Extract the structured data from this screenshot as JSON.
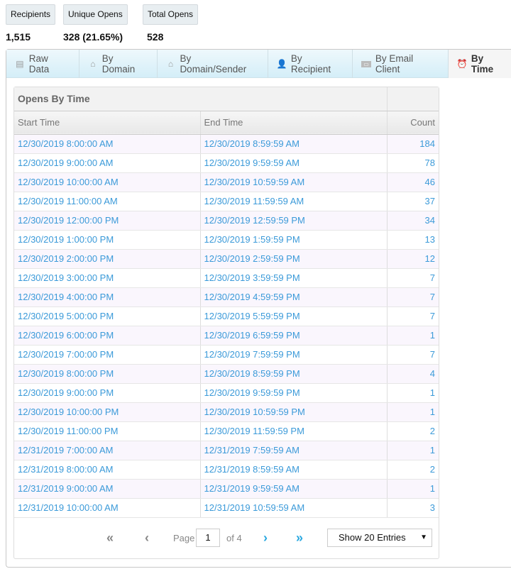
{
  "stats": [
    {
      "label": "Recipients",
      "value": "1,515"
    },
    {
      "label": "Unique Opens",
      "value": "328 (21.65%)"
    },
    {
      "label": "Total Opens",
      "value": "528"
    }
  ],
  "tabs": [
    {
      "label": "Raw Data",
      "icon": "table-icon"
    },
    {
      "label": "By Domain",
      "icon": "house-icon"
    },
    {
      "label": "By Domain/Sender",
      "icon": "house-icon"
    },
    {
      "label": "By Recipient",
      "icon": "person-icon"
    },
    {
      "label": "By Email Client",
      "icon": "html-icon"
    },
    {
      "label": "By Time",
      "icon": "alarm-clock-icon",
      "active": true
    }
  ],
  "table": {
    "title": "Opens By Time",
    "headers": [
      "Start Time",
      "End Time",
      "Count"
    ],
    "rows": [
      [
        "12/30/2019 8:00:00 AM",
        "12/30/2019 8:59:59 AM",
        "184"
      ],
      [
        "12/30/2019 9:00:00 AM",
        "12/30/2019 9:59:59 AM",
        "78"
      ],
      [
        "12/30/2019 10:00:00 AM",
        "12/30/2019 10:59:59 AM",
        "46"
      ],
      [
        "12/30/2019 11:00:00 AM",
        "12/30/2019 11:59:59 AM",
        "37"
      ],
      [
        "12/30/2019 12:00:00 PM",
        "12/30/2019 12:59:59 PM",
        "34"
      ],
      [
        "12/30/2019 1:00:00 PM",
        "12/30/2019 1:59:59 PM",
        "13"
      ],
      [
        "12/30/2019 2:00:00 PM",
        "12/30/2019 2:59:59 PM",
        "12"
      ],
      [
        "12/30/2019 3:00:00 PM",
        "12/30/2019 3:59:59 PM",
        "7"
      ],
      [
        "12/30/2019 4:00:00 PM",
        "12/30/2019 4:59:59 PM",
        "7"
      ],
      [
        "12/30/2019 5:00:00 PM",
        "12/30/2019 5:59:59 PM",
        "7"
      ],
      [
        "12/30/2019 6:00:00 PM",
        "12/30/2019 6:59:59 PM",
        "1"
      ],
      [
        "12/30/2019 7:00:00 PM",
        "12/30/2019 7:59:59 PM",
        "7"
      ],
      [
        "12/30/2019 8:00:00 PM",
        "12/30/2019 8:59:59 PM",
        "4"
      ],
      [
        "12/30/2019 9:00:00 PM",
        "12/30/2019 9:59:59 PM",
        "1"
      ],
      [
        "12/30/2019 10:00:00 PM",
        "12/30/2019 10:59:59 PM",
        "1"
      ],
      [
        "12/30/2019 11:00:00 PM",
        "12/30/2019 11:59:59 PM",
        "2"
      ],
      [
        "12/31/2019 7:00:00 AM",
        "12/31/2019 7:59:59 AM",
        "1"
      ],
      [
        "12/31/2019 8:00:00 AM",
        "12/31/2019 8:59:59 AM",
        "2"
      ],
      [
        "12/31/2019 9:00:00 AM",
        "12/31/2019 9:59:59 AM",
        "1"
      ],
      [
        "12/31/2019 10:00:00 AM",
        "12/31/2019 10:59:59 AM",
        "3"
      ]
    ]
  },
  "pager": {
    "page_label": "Page",
    "page": "1",
    "of_label": "of 4",
    "entries": "Show 20 Entries"
  },
  "colors": {
    "link": "#3b9ad9",
    "accent": "#29a8e0"
  }
}
